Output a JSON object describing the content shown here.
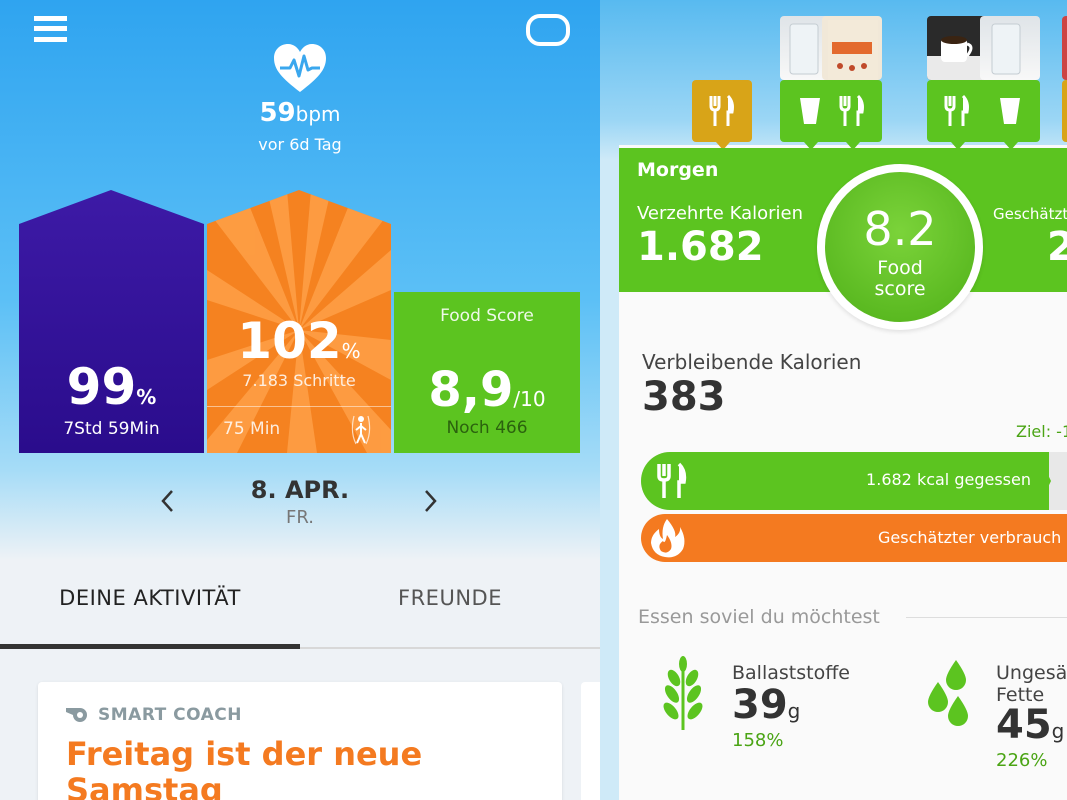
{
  "left": {
    "heart_rate": {
      "value": "59",
      "unit": "bpm",
      "sub": "vor 6d Tag"
    },
    "sleep": {
      "percent": "99",
      "pct_sign": "%",
      "sub": "7Std 59Min",
      "color": "#3a1aa8"
    },
    "steps": {
      "percent": "102",
      "pct_sign": "%",
      "sub": "7.183 Schritte",
      "minutes": "75 Min",
      "color": "#f58220"
    },
    "food": {
      "label": "Food Score",
      "value": "8,9",
      "suffix": "/10",
      "sub": "Noch 466",
      "color": "#5cc420"
    },
    "date": {
      "main": "8. APR.",
      "sub": "FR."
    },
    "tabs": [
      {
        "label": "DEINE AKTIVITÄT"
      },
      {
        "label": "FREUNDE"
      }
    ],
    "coach": {
      "label": "SMART COACH",
      "title": "Freitag ist der neue Samstag"
    }
  },
  "right": {
    "meal": "Morgen",
    "eaten_label": "Verzehrte Kalorien",
    "eaten_value": "1.682",
    "estimated_label": "Geschätzt",
    "estimated_value": "2",
    "score": {
      "value": "8.2",
      "label_line1": "Food",
      "label_line2": "score"
    },
    "remaining_label": "Verbleibende Kalorien",
    "remaining_value": "383",
    "goal": "Ziel: -1",
    "eaten_bar_text": "1.682 kcal gegessen",
    "burn_bar_text": "Geschätzter verbrauch",
    "eat_section_title": "Essen soviel du möchtest",
    "fiber": {
      "label": "Ballaststoffe",
      "value": "39",
      "unit": "g",
      "pct": "158%"
    },
    "fat": {
      "label_line1": "Ungesä",
      "label_line2": "Fette",
      "value": "45",
      "unit": "g",
      "pct": "226%"
    },
    "colors": {
      "green": "#5cc420",
      "orange": "#f47a20",
      "gold": "#d8a418"
    }
  }
}
